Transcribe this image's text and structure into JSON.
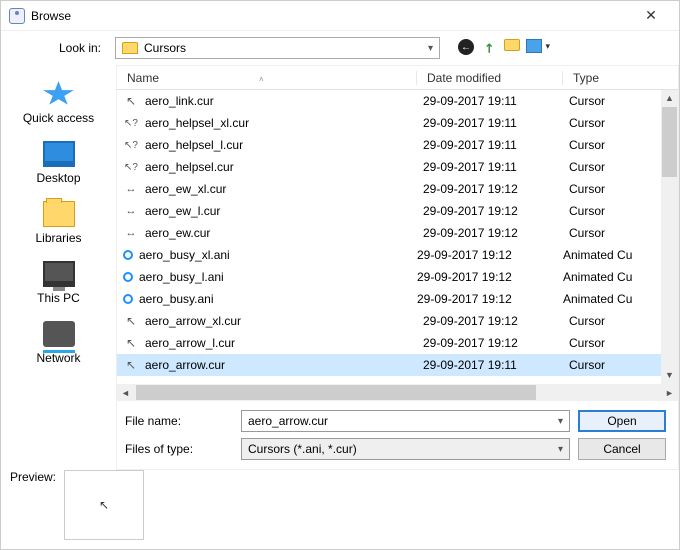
{
  "title": "Browse",
  "lookin": {
    "label": "Look in:",
    "value": "Cursors"
  },
  "sidebar": [
    {
      "label": "Quick access"
    },
    {
      "label": "Desktop"
    },
    {
      "label": "Libraries"
    },
    {
      "label": "This PC"
    },
    {
      "label": "Network"
    }
  ],
  "columns": {
    "name": "Name",
    "date": "Date modified",
    "type": "Type"
  },
  "files": [
    {
      "name": "aero_arrow.cur",
      "date": "29-09-2017 19:11",
      "type": "Cursor",
      "icon": "cursor",
      "selected": true
    },
    {
      "name": "aero_arrow_l.cur",
      "date": "29-09-2017 19:12",
      "type": "Cursor",
      "icon": "cursor"
    },
    {
      "name": "aero_arrow_xl.cur",
      "date": "29-09-2017 19:12",
      "type": "Cursor",
      "icon": "cursor"
    },
    {
      "name": "aero_busy.ani",
      "date": "29-09-2017 19:12",
      "type": "Animated Cu",
      "icon": "busy"
    },
    {
      "name": "aero_busy_l.ani",
      "date": "29-09-2017 19:12",
      "type": "Animated Cu",
      "icon": "busy"
    },
    {
      "name": "aero_busy_xl.ani",
      "date": "29-09-2017 19:12",
      "type": "Animated Cu",
      "icon": "busy"
    },
    {
      "name": "aero_ew.cur",
      "date": "29-09-2017 19:12",
      "type": "Cursor",
      "icon": "ew"
    },
    {
      "name": "aero_ew_l.cur",
      "date": "29-09-2017 19:12",
      "type": "Cursor",
      "icon": "ew"
    },
    {
      "name": "aero_ew_xl.cur",
      "date": "29-09-2017 19:12",
      "type": "Cursor",
      "icon": "ew"
    },
    {
      "name": "aero_helpsel.cur",
      "date": "29-09-2017 19:11",
      "type": "Cursor",
      "icon": "help"
    },
    {
      "name": "aero_helpsel_l.cur",
      "date": "29-09-2017 19:11",
      "type": "Cursor",
      "icon": "help"
    },
    {
      "name": "aero_helpsel_xl.cur",
      "date": "29-09-2017 19:11",
      "type": "Cursor",
      "icon": "help"
    },
    {
      "name": "aero_link.cur",
      "date": "29-09-2017 19:11",
      "type": "Cursor",
      "icon": "cursor"
    }
  ],
  "filename": {
    "label": "File name:",
    "value": "aero_arrow.cur"
  },
  "filter": {
    "label": "Files of type:",
    "value": "Cursors (*.ani, *.cur)"
  },
  "buttons": {
    "open": "Open",
    "cancel": "Cancel"
  },
  "preview": {
    "label": "Preview:"
  }
}
